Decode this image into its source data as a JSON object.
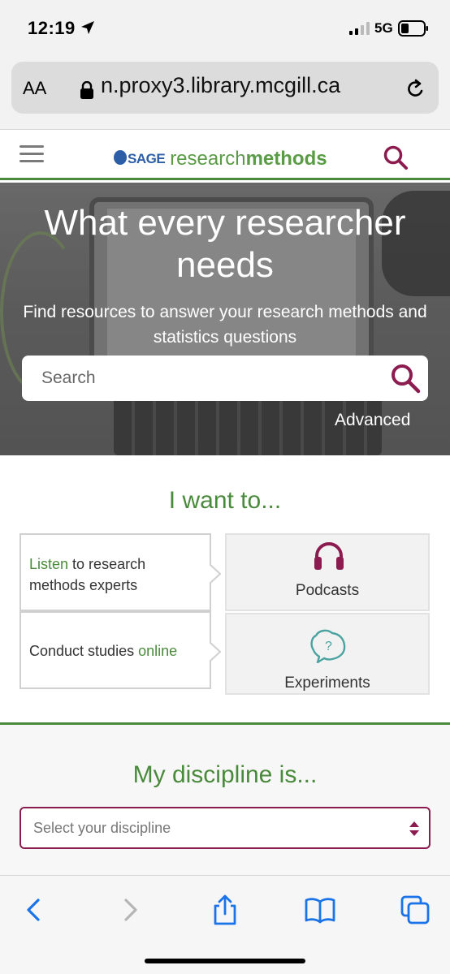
{
  "status_bar": {
    "time": "12:19",
    "network": "5G"
  },
  "browser": {
    "text_size_button": "AA",
    "url": "n.proxy3.library.mcgill.ca"
  },
  "header": {
    "logo_sage": "SAGE",
    "logo_research": "research",
    "logo_methods": "methods"
  },
  "hero": {
    "title": "What every researcher needs",
    "subtitle": "Find resources to answer your research methods and statistics questions",
    "search_placeholder": "Search",
    "advanced_label": "Advanced"
  },
  "want": {
    "title": "I want to...",
    "options": [
      {
        "highlight": "Listen",
        "text_after": " to research methods experts"
      },
      {
        "text_before": "Conduct studies ",
        "highlight": "online"
      }
    ],
    "media": [
      {
        "label": "Podcasts",
        "icon": "headphones-icon"
      },
      {
        "label": "Experiments",
        "icon": "brain-question-icon"
      }
    ]
  },
  "discipline": {
    "title": "My discipline is...",
    "select_placeholder": "Select your discipline"
  },
  "colors": {
    "brand_green": "#4a8a3c",
    "accent_maroon": "#8c1c4f",
    "sage_blue": "#2b5ea7",
    "ios_blue": "#1a73e8"
  }
}
